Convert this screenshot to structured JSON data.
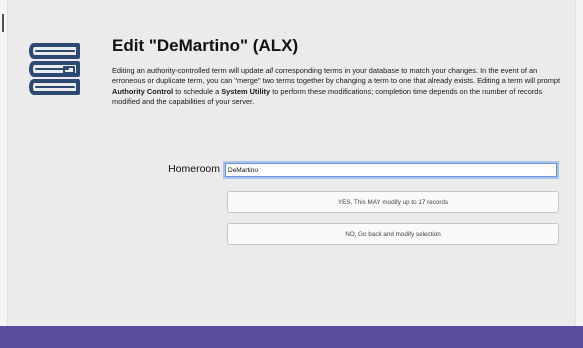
{
  "dialog": {
    "title": "Edit \"DeMartino\" (ALX)",
    "description": {
      "p1": "Editing an authority-controlled term will update ",
      "emph_all": "all",
      "p2": " corresponding terms in your database to match your changes. In the event of an erroneous or duplicate term, you can \"merge\" two terms together by changing a term to one that already exists. Editing a term will prompt ",
      "bold_authority": "Authority Control",
      "p3": " to schedule a ",
      "bold_utility": "System Utility",
      "p4": " to perform these modifications; completion time depends on the number of records modified and the capabilities of your server."
    },
    "field": {
      "label": "Homeroom",
      "value": "DeMartino"
    },
    "buttons": {
      "confirm_label": "YES, This MAY modify up to 17 records",
      "cancel_label": "NO, Go back and modify selection"
    }
  },
  "icons": {
    "books": "books-stack-icon"
  },
  "colors": {
    "accent": "#5b4d9e",
    "icon_navy": "#2c4873",
    "focus_ring": "#a9c3ef"
  }
}
